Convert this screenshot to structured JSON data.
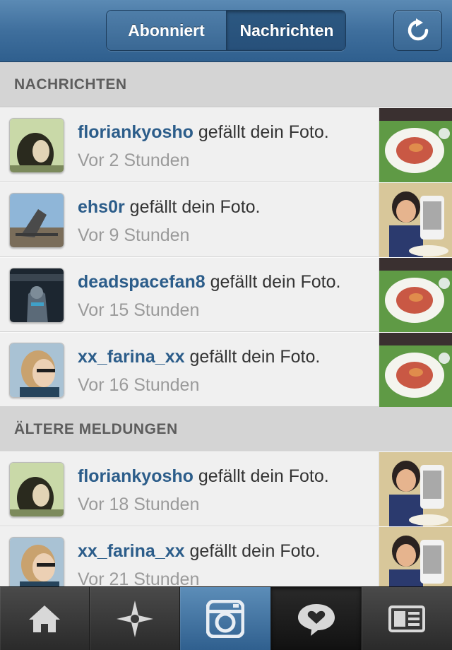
{
  "header": {
    "tab_following": "Abonniert",
    "tab_news": "Nachrichten",
    "refresh_icon": "refresh-icon"
  },
  "sections": {
    "news": "NACHRICHTEN",
    "older": "ÄLTERE MELDUNGEN"
  },
  "news_items": [
    {
      "user": "floriankyosho",
      "action": " gefällt dein Foto.",
      "time": "Vor 2 Stunden",
      "photo": "pasta-plate"
    },
    {
      "user": "ehs0r",
      "action": " gefällt dein Foto.",
      "time": "Vor 9 Stunden",
      "photo": "woman-phone"
    },
    {
      "user": "deadspacefan8",
      "action": " gefällt dein Foto.",
      "time": "Vor 15 Stunden",
      "photo": "pasta-plate"
    },
    {
      "user": "xx_farina_xx",
      "action": " gefällt dein Foto.",
      "time": "Vor 16 Stunden",
      "photo": "pasta-plate"
    }
  ],
  "older_items": [
    {
      "user": "floriankyosho",
      "action": " gefällt dein Foto.",
      "time": "Vor 18 Stunden",
      "photo": "woman-phone"
    },
    {
      "user": "xx_farina_xx",
      "action": " gefällt dein Foto.",
      "time": "Vor 21 Stunden",
      "photo": "woman-phone"
    }
  ],
  "tabbar": {
    "icons": [
      "home-icon",
      "explore-icon",
      "camera-icon",
      "news-heart-icon",
      "profile-icon"
    ],
    "active": "camera-icon"
  },
  "colors": {
    "username": "#2c5d8a",
    "timestamp": "#9a9a9a",
    "header_blue": "#3f6f9d"
  }
}
